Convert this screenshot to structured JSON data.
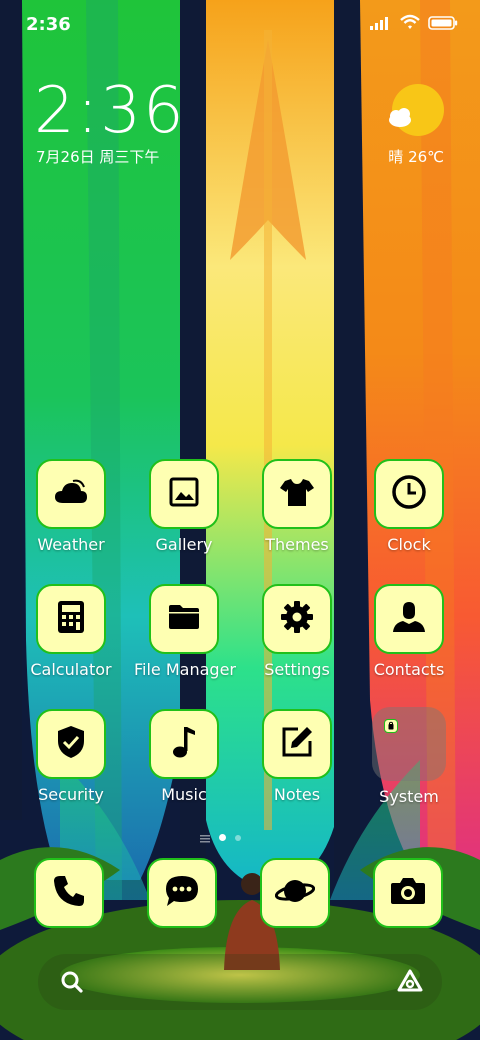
{
  "status": {
    "time": "2:36"
  },
  "lockclock": {
    "time": "2:36",
    "date": "7月26日 周三下午"
  },
  "weather": {
    "temp_label": "晴 26℃",
    "icon": "sun-icon"
  },
  "apps": [
    {
      "label": "Weather",
      "icon": "weather-icon"
    },
    {
      "label": "Gallery",
      "icon": "image-icon"
    },
    {
      "label": "Themes",
      "icon": "tshirt-icon"
    },
    {
      "label": "Clock",
      "icon": "clock-icon"
    },
    {
      "label": "Calculator",
      "icon": "calculator-icon"
    },
    {
      "label": "File Manager",
      "icon": "folder-icon"
    },
    {
      "label": "Settings",
      "icon": "gear-icon"
    },
    {
      "label": "Contacts",
      "icon": "person-icon"
    },
    {
      "label": "Security",
      "icon": "shield-check-icon"
    },
    {
      "label": "Music",
      "icon": "music-note-icon"
    },
    {
      "label": "Notes",
      "icon": "note-edit-icon"
    },
    {
      "label": "System",
      "icon": "folder-icon"
    }
  ],
  "dock": [
    {
      "icon": "phone-icon"
    },
    {
      "icon": "message-icon"
    },
    {
      "icon": "planet-icon"
    },
    {
      "icon": "camera-icon"
    }
  ],
  "colors": {
    "tile_bg": "#feffb2",
    "tile_border": "#21c01a"
  }
}
